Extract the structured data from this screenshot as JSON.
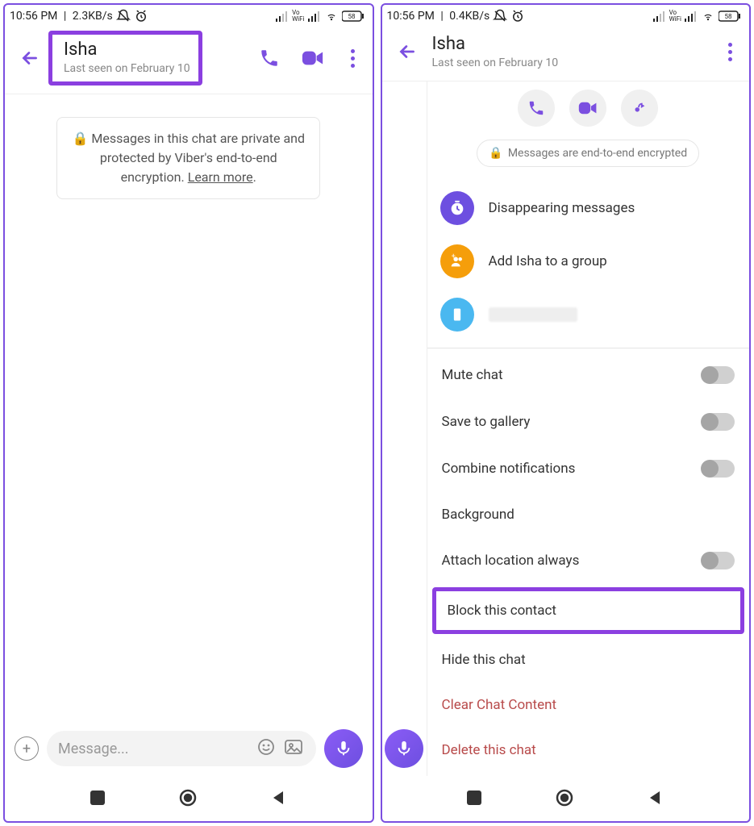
{
  "left": {
    "status": {
      "time": "10:56 PM",
      "net": "2.3KB/s",
      "battery": "58"
    },
    "contact": {
      "name": "Isha",
      "sub": "Last seen on February 10"
    },
    "e2e": {
      "lock": "🔒",
      "text1": "Messages in this chat are private and",
      "text2": "protected by Viber's end-to-end",
      "text3": "encryption.",
      "learn": "Learn more"
    },
    "input": {
      "placeholder": "Message..."
    }
  },
  "right": {
    "status": {
      "time": "10:56 PM",
      "net": "0.4KB/s",
      "battery": "58"
    },
    "contact": {
      "name": "Isha",
      "sub": "Last seen on February 10"
    },
    "enc_pill": "Messages are end-to-end encrypted",
    "items": {
      "disappearing": "Disappearing messages",
      "add_group": "Add Isha to a group"
    },
    "settings": {
      "mute": "Mute chat",
      "save": "Save to gallery",
      "combine": "Combine notifications",
      "background": "Background",
      "location": "Attach location always",
      "block": "Block this contact",
      "hide": "Hide this chat",
      "clear": "Clear Chat Content",
      "delete": "Delete this chat"
    }
  }
}
